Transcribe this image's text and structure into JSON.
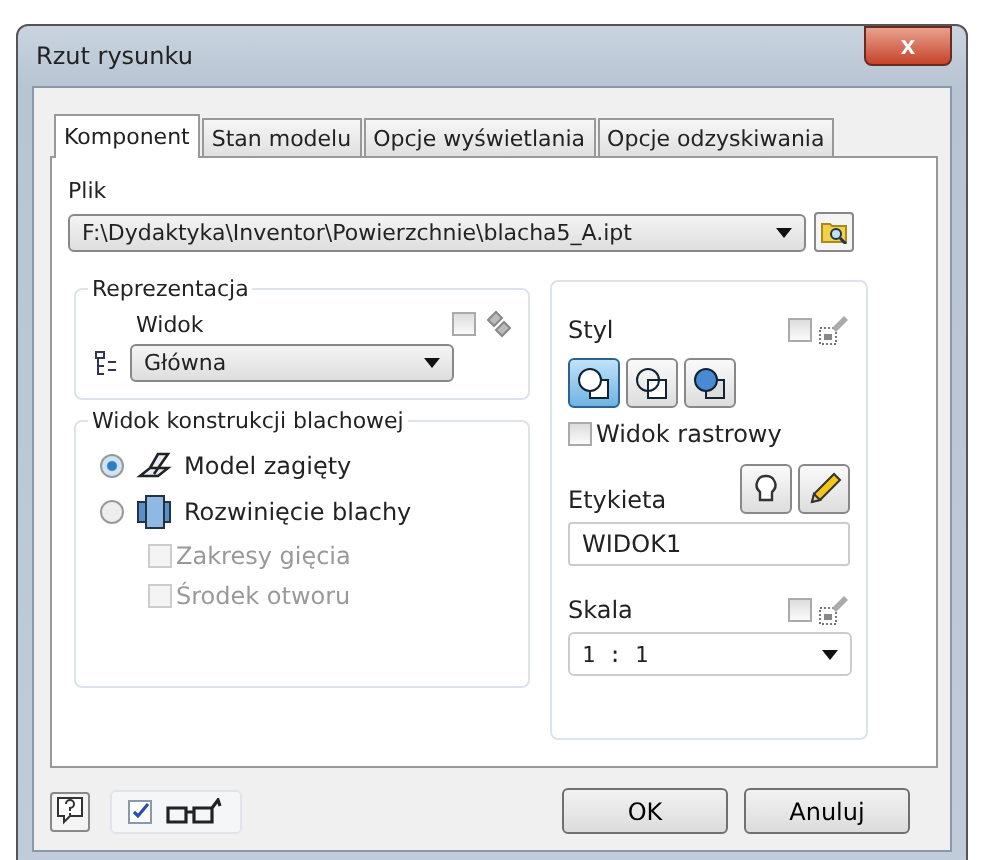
{
  "window": {
    "title": "Rzut rysunku",
    "close": "x"
  },
  "tabs": [
    {
      "label": "Komponent",
      "selected": true
    },
    {
      "label": "Stan modelu",
      "selected": false
    },
    {
      "label": "Opcje wyświetlania",
      "selected": false
    },
    {
      "label": "Opcje odzyskiwania",
      "selected": false
    }
  ],
  "file": {
    "label": "Plik",
    "value": "F:\\Dydaktyka\\Inventor\\Powierzchnie\\blacha5_A.ipt"
  },
  "representation": {
    "legend": "Reprezentacja",
    "view_label": "Widok",
    "view_checked": false,
    "value": "Główna"
  },
  "sheet_metal": {
    "legend": "Widok konstrukcji blachowej",
    "options": [
      {
        "label": "Model zagięty",
        "kind": "folded",
        "selected": true
      },
      {
        "label": "Rozwinięcie blachy",
        "kind": "flat",
        "selected": false
      }
    ],
    "checkboxes": [
      {
        "label": "Zakresy gięcia",
        "checked": false,
        "disabled": true
      },
      {
        "label": "Środek otworu",
        "checked": false,
        "disabled": true
      }
    ]
  },
  "style": {
    "label": "Styl",
    "checked": false,
    "buttons": [
      {
        "kind": "hidden",
        "selected": true
      },
      {
        "kind": "wire",
        "selected": false
      },
      {
        "kind": "shaded",
        "selected": false
      }
    ],
    "raster": {
      "label": "Widok rastrowy",
      "checked": false
    }
  },
  "etykieta": {
    "label": "Etykieta",
    "value": "WIDOK1"
  },
  "scale": {
    "label": "Skala",
    "checked": false,
    "value": "1 : 1"
  },
  "footer": {
    "preview_checked": true
  },
  "buttons": [
    {
      "label": "OK"
    },
    {
      "label": "Anuluj"
    }
  ]
}
